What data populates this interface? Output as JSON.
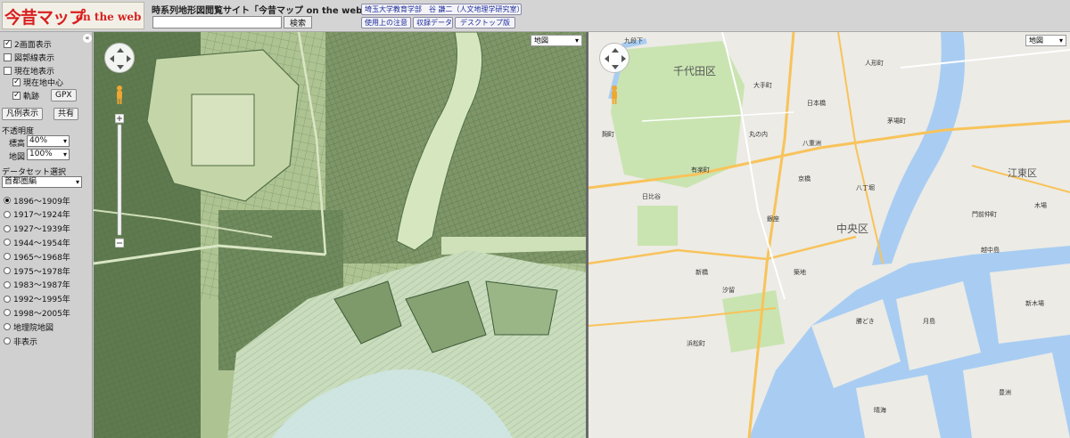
{
  "header": {
    "logo_main": "今昔マップ",
    "logo_sub": "on the web",
    "site_title": "時系列地形図閲覧サイト「今昔マップ on the web」",
    "search_placeholder": "",
    "search_button": "検索",
    "author_button": "埼玉大学教育学部　谷 謙二（人文地理学研究室）",
    "notes_button": "使用上の注意",
    "data_button": "収録データ",
    "desktop_button": "デスクトップ版"
  },
  "sidebar": {
    "collapse_glyph": "«",
    "checkboxes": [
      {
        "label": "2画面表示",
        "checked": true
      },
      {
        "label": "図郭線表示",
        "checked": false
      },
      {
        "label": "現在地表示",
        "checked": false
      },
      {
        "label": "現在地中心",
        "checked": true
      },
      {
        "label": "軌跡",
        "checked": true
      }
    ],
    "gpx_button": "GPX",
    "legend_button": "凡例表示",
    "share_button": "共有",
    "opacity_title": "不透明度",
    "opacity_rows": [
      {
        "label": "標高",
        "value": "40%"
      },
      {
        "label": "地図",
        "value": "100%"
      }
    ],
    "dataset_title": "データセット選択",
    "dataset_value": "首都圏編",
    "periods": [
      {
        "label": "1896〜1909年",
        "selected": true
      },
      {
        "label": "1917〜1924年",
        "selected": false
      },
      {
        "label": "1927〜1939年",
        "selected": false
      },
      {
        "label": "1944〜1954年",
        "selected": false
      },
      {
        "label": "1965〜1968年",
        "selected": false
      },
      {
        "label": "1975〜1978年",
        "selected": false
      },
      {
        "label": "1983〜1987年",
        "selected": false
      },
      {
        "label": "1992〜1995年",
        "selected": false
      },
      {
        "label": "1998〜2005年",
        "selected": false
      },
      {
        "label": "地理院地図",
        "selected": false
      },
      {
        "label": "非表示",
        "selected": false
      }
    ]
  },
  "left_map": {
    "map_type": "地図"
  },
  "right_map": {
    "map_type": "地図",
    "labels": {
      "chiyoda": "千代田区",
      "chuo": "中央区",
      "kojimachi": "麹町",
      "yaesu": "八重洲",
      "nihonbashi": "日本橋",
      "ginza": "銀座",
      "tsukiji": "築地",
      "tsukishima": "月島",
      "kachidoki": "勝どき",
      "harumi": "晴海",
      "toyosu": "豊洲",
      "shinbashi": "新橋",
      "hamamatsucho": "浜松町",
      "hibiya": "日比谷",
      "kyobashi": "京橋",
      "otemachi": "大手町",
      "koto": "江東区",
      "kiba": "木場",
      "monzen": "門前仲町",
      "etchujima": "越中島",
      "shiodome": "汐留",
      "ningyocho": "人形町",
      "kayabacho": "茅場町",
      "hatchobori": "八丁堀",
      "kudanshita": "九段下",
      "marunouchi": "丸の内",
      "yurakucho": "有楽町",
      "shinkiba": "新木場"
    }
  },
  "colors": {
    "left_map_base": "#b6c99c",
    "right_map_base": "#ecebe6",
    "water": "#a9cdf2",
    "park": "#c9e4b0",
    "road_major": "#f8c35a",
    "logo_red": "#d82020",
    "link_blue": "#1a2a9a"
  },
  "icons": {
    "pan_control": "pan-control-icon",
    "pegman": "pegman-icon",
    "zoom": "zoom-slider-icon"
  }
}
